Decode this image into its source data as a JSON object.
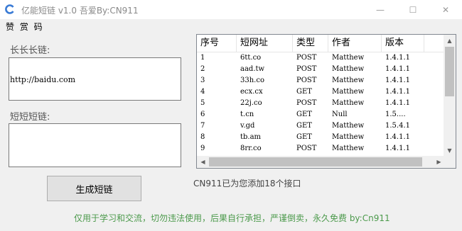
{
  "window": {
    "title": "亿能短链 v1.0 吾爱By:CN911",
    "controls": {
      "minimize": "—",
      "maximize": "☐",
      "close": "✕"
    }
  },
  "menu": {
    "item": "赞 赏 码"
  },
  "form": {
    "long_label": "长长长链:",
    "long_value": "http://baidu.com",
    "short_label": "短短短链:",
    "short_value": "",
    "generate_button": "生成短链"
  },
  "table": {
    "headers": [
      "序号",
      "短网址",
      "类型",
      "作者",
      "版本"
    ],
    "rows": [
      [
        "1",
        "6tt.co",
        "POST",
        "Matthew",
        "1.4.1.1"
      ],
      [
        "2",
        "aad.tw",
        "POST",
        "Matthew",
        "1.4.1.1"
      ],
      [
        "3",
        "33h.co",
        "POST",
        "Matthew",
        "1.4.1.1"
      ],
      [
        "4",
        "ecx.cx",
        "GET",
        "Matthew",
        "1.4.1.1"
      ],
      [
        "5",
        "22j.co",
        "POST",
        "Matthew",
        "1.4.1.1"
      ],
      [
        "6",
        "t.cn",
        "GET",
        "Null",
        "1.5...."
      ],
      [
        "7",
        "v.gd",
        "GET",
        "Matthew",
        "1.5.4.1"
      ],
      [
        "8",
        "tb.am",
        "GET",
        "Matthew",
        "1.4.1.1"
      ],
      [
        "9",
        "8rr.co",
        "POST",
        "Matthew",
        "1.4.1.1"
      ]
    ]
  },
  "status": "CN911已为您添加18个接口",
  "footer": "仅用于学习和交流，切勿违法使用，后果自行承担，严谨倒卖，永久免费 by:Cn911",
  "colors": {
    "footer_text": "#4c9a4c",
    "app_icon": "#3a7bd5"
  }
}
